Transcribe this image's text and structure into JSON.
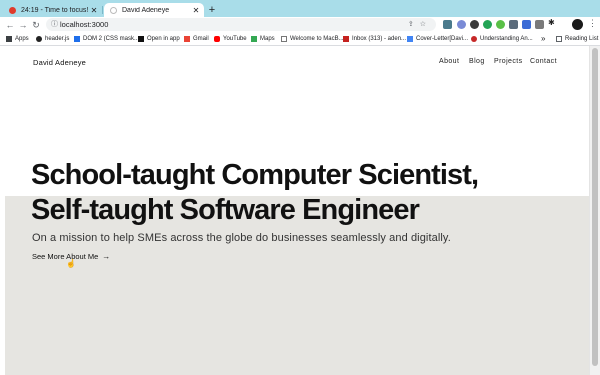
{
  "browser": {
    "tabs": [
      {
        "label": "24:19 - Time to focus!",
        "close": "✕"
      },
      {
        "label": "David Adeneye",
        "close": "✕"
      }
    ],
    "new_tab": "+",
    "url": "localhost:3000",
    "bookmarks": [
      {
        "label": "Apps",
        "color": "#3c4043"
      },
      {
        "label": "header.js",
        "color": "#222222"
      },
      {
        "label": "DOM 2 (CSS mask...",
        "color": "#1f6feb"
      },
      {
        "label": "Open in app",
        "color": "#111111"
      },
      {
        "label": "Gmail",
        "color": "#ea4335"
      },
      {
        "label": "YouTube",
        "color": "#ff0000"
      },
      {
        "label": "Maps",
        "color": "#34a853"
      },
      {
        "label": "Welcome to MacB...",
        "color": "#555555"
      },
      {
        "label": "Inbox (313) - aden...",
        "color": "#c5221f"
      },
      {
        "label": "Cover-Letter[Davi...",
        "color": "#4285f4"
      },
      {
        "label": "Understanding An...",
        "color": "#c62828"
      }
    ],
    "more_bookmarks": "»",
    "reading_list": "Reading List"
  },
  "site": {
    "brand": "David Adeneye",
    "nav": [
      "About",
      "Blog",
      "Projects",
      "Contact"
    ],
    "headline_line1": "School-taught Computer Scientist,",
    "headline_line2": "Self-taught Software Engineer",
    "subtitle": "On a mission to help SMEs across the globe do businesses seamlessly and digitally.",
    "cta": "See More About Me",
    "cta_arrow": "→",
    "hero_bg_color": "#e6e5e1"
  }
}
